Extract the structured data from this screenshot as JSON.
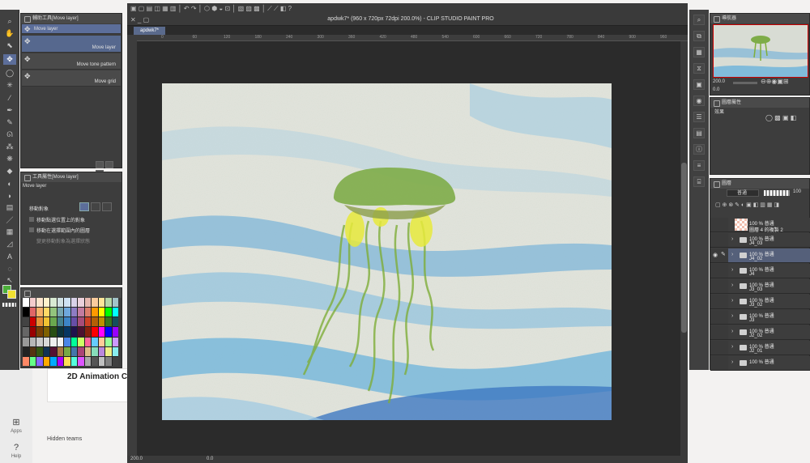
{
  "background_app": {
    "card_title": "2D Animation C",
    "rail": [
      {
        "label": "Apps",
        "icon": "apps-icon"
      },
      {
        "label": "Help",
        "icon": "help-icon"
      }
    ],
    "hidden_teams": "Hidden teams"
  },
  "window": {
    "title": "apdwk7* (960 x 720px 72dpi 200.0%) - CLIP STUDIO PAINT PRO",
    "tab": "apdwk7*"
  },
  "ruler_ticks": [
    "0",
    "60",
    "120",
    "180",
    "240",
    "300",
    "360",
    "420",
    "480",
    "540",
    "600",
    "660",
    "720",
    "780",
    "840",
    "900",
    "960"
  ],
  "sub_tool": {
    "title": "輔助工具[Move layer]",
    "header": "Move layer",
    "items": [
      "Move layer",
      "Move tone pattern",
      "Move grid"
    ]
  },
  "tool_property": {
    "title": "工具屬性[Move layer]",
    "tool_name": "Move layer",
    "target_label": "移動對象",
    "options": [
      "移動點選位置上的對象",
      "移動在選擇範圍內的圖層",
      "變更移動對象為選擇狀態"
    ]
  },
  "statusbar": {
    "zoom": "200.0",
    "angle": "0.0"
  },
  "navigator": {
    "title": "導航器",
    "zoom": "200.0",
    "angle": "0.0"
  },
  "layer_property": {
    "title": "圖層屬性",
    "effect_label": "效果"
  },
  "layers_panel": {
    "title": "圖層",
    "blend_mode": "普通",
    "opacity": "100",
    "layers": [
      {
        "line1": "100 % 普通",
        "line2": "圖層 4 的複製 2",
        "type": "raster",
        "selected": false
      },
      {
        "line1": "100 % 普通",
        "line2": "J4_03",
        "type": "folder",
        "selected": false
      },
      {
        "line1": "100 % 普通",
        "line2": "J4_02",
        "type": "folder",
        "selected": true
      },
      {
        "line1": "100 % 普通",
        "line2": "J4",
        "type": "folder",
        "selected": false
      },
      {
        "line1": "100 % 普通",
        "line2": "J3_03",
        "type": "folder",
        "selected": false
      },
      {
        "line1": "100 % 普通",
        "line2": "J3_02",
        "type": "folder",
        "selected": false
      },
      {
        "line1": "100 % 普通",
        "line2": "J3",
        "type": "folder",
        "selected": false
      },
      {
        "line1": "100 % 普通",
        "line2": "J2_02",
        "type": "folder",
        "selected": false
      },
      {
        "line1": "100 % 普通",
        "line2": "J2_01",
        "type": "folder",
        "selected": false
      },
      {
        "line1": "100 % 普通",
        "line2": "",
        "type": "folder",
        "selected": false
      }
    ]
  },
  "colors": {
    "main": "#4caf3a",
    "sub": "#f0e030",
    "accent": "#5c6e9a"
  }
}
